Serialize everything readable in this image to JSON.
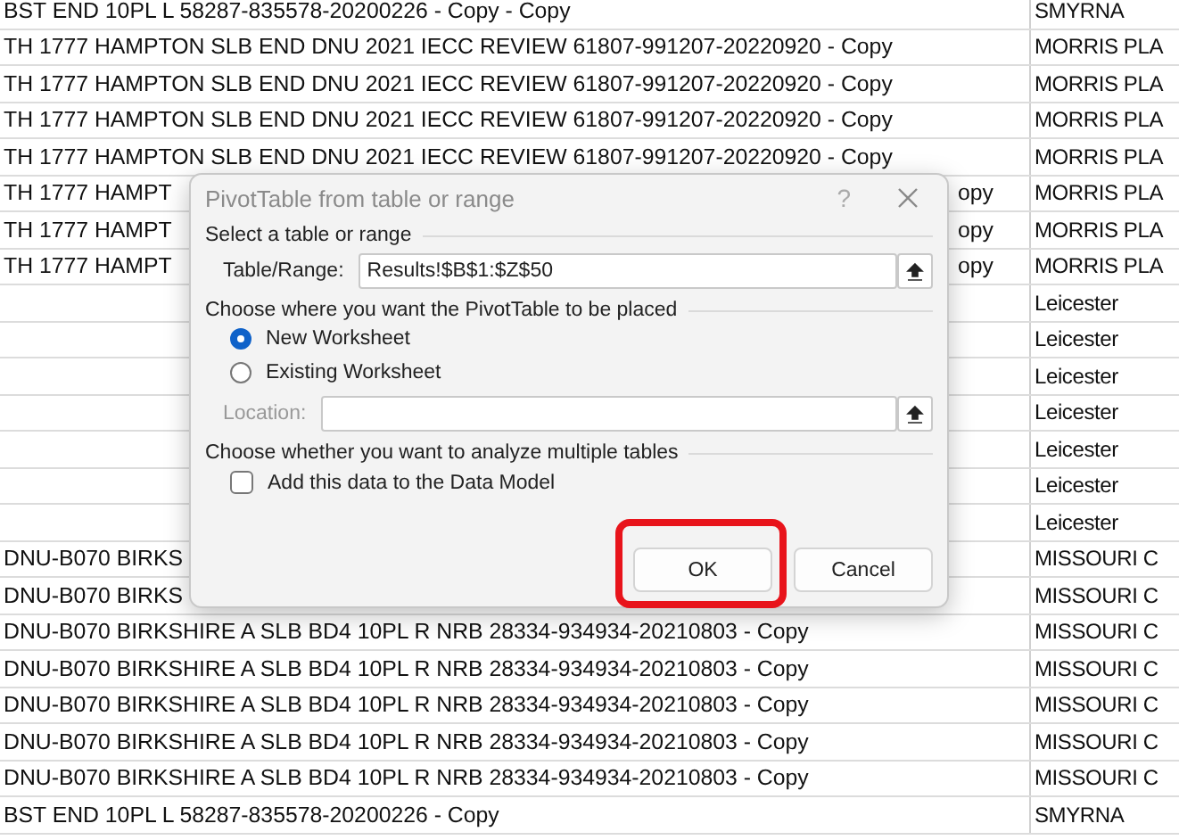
{
  "sheet": {
    "rows": [
      {
        "column_1": "BST END 10PL L 58287-835578-20200226 - Copy - Copy",
        "column_2": "SMYRNA"
      },
      {
        "column_1": "TH 1777 HAMPTON SLB END  DNU 2021 IECC REVIEW 61807-991207-20220920 - Copy",
        "column_2": "MORRIS PLA"
      },
      {
        "column_1": "TH 1777 HAMPTON SLB END  DNU 2021 IECC REVIEW 61807-991207-20220920 - Copy",
        "column_2": "MORRIS PLA"
      },
      {
        "column_1": "TH 1777 HAMPTON SLB END  DNU 2021 IECC REVIEW 61807-991207-20220920 - Copy",
        "column_2": "MORRIS PLA"
      },
      {
        "column_1": "TH 1777 HAMPTON SLB END  DNU 2021 IECC REVIEW 61807-991207-20220920 - Copy",
        "column_2": "MORRIS PLA"
      },
      {
        "column_1_left": "TH 1777 HAMPT",
        "column_1_right": "opy",
        "column_2": "MORRIS PLA"
      },
      {
        "column_1_left": "TH 1777 HAMPT",
        "column_1_right": "opy",
        "column_2": "MORRIS PLA"
      },
      {
        "column_1_left": "TH 1777 HAMPT",
        "column_1_right": "opy",
        "column_2": "MORRIS PLA"
      },
      {
        "column_2": "Leicester"
      },
      {
        "column_2": "Leicester"
      },
      {
        "column_2": "Leicester"
      },
      {
        "column_2": "Leicester"
      },
      {
        "column_2": "Leicester"
      },
      {
        "column_2": "Leicester"
      },
      {
        "column_2": "Leicester"
      },
      {
        "column_1_left": "DNU-B070 BIRKS",
        "column_2": "MISSOURI C"
      },
      {
        "column_1_left": "DNU-B070 BIRKS",
        "column_2": "MISSOURI C"
      },
      {
        "column_1": "DNU-B070 BIRKSHIRE A SLB BD4 10PL R NRB 28334-934934-20210803 - Copy",
        "column_2": "MISSOURI C"
      },
      {
        "column_1": "DNU-B070 BIRKSHIRE A SLB BD4 10PL R NRB 28334-934934-20210803 - Copy",
        "column_2": "MISSOURI C"
      },
      {
        "column_1": "DNU-B070 BIRKSHIRE A SLB BD4 10PL R NRB 28334-934934-20210803 - Copy",
        "column_2": "MISSOURI C"
      },
      {
        "column_1": "DNU-B070 BIRKSHIRE A SLB BD4 10PL R NRB 28334-934934-20210803 - Copy",
        "column_2": "MISSOURI C"
      },
      {
        "column_1": "DNU-B070 BIRKSHIRE A SLB BD4 10PL R NRB 28334-934934-20210803 - Copy",
        "column_2": "MISSOURI C"
      },
      {
        "column_1": "BST END 10PL L 58287-835578-20200226 - Copy",
        "column_2": "SMYRNA"
      }
    ]
  },
  "dialog": {
    "title": "PivotTable from table or range",
    "help": "?",
    "section_1": "Select a table or range",
    "range_label": "Table/Range:",
    "range_value": "Results!$B$1:$Z$50",
    "section_2": "Choose where you want the PivotTable to be placed",
    "options": [
      {
        "label": "New Worksheet",
        "selected": true
      },
      {
        "label": "Existing Worksheet",
        "selected": false
      }
    ],
    "location_label": "Location:",
    "location_disabled": true,
    "section_3": "Choose whether you want to analyze multiple tables",
    "data_model": {
      "label": "Add this data to the Data Model",
      "checked": false
    },
    "buttons": [
      {
        "label": "OK"
      },
      {
        "label": "Cancel"
      }
    ],
    "ok_highlight_frame": true
  }
}
